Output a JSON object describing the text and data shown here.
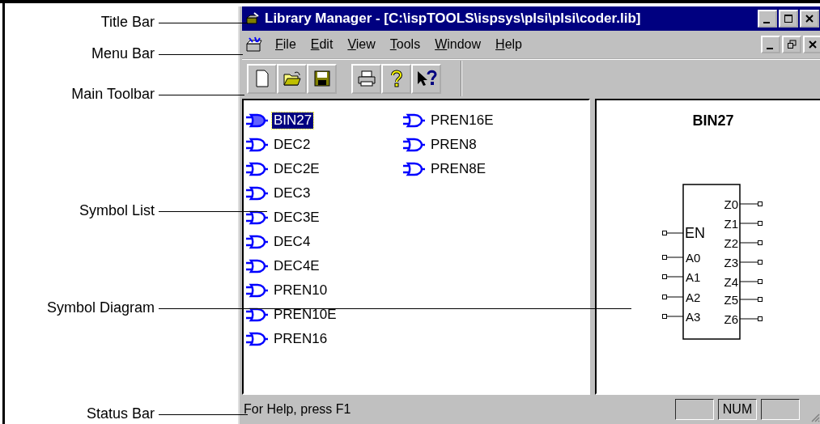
{
  "callouts": [
    "Title Bar",
    "Menu Bar",
    "Main Toolbar",
    "Symbol List",
    "Symbol Diagram",
    "Status Bar"
  ],
  "window": {
    "title": "Library Manager - [C:\\ispTOOLS\\ispsys\\plsi\\plsi\\coder.lib]"
  },
  "menu": [
    "File",
    "Edit",
    "View",
    "Tools",
    "Window",
    "Help"
  ],
  "symbols": [
    {
      "name": "BIN27",
      "selected": true
    },
    {
      "name": "DEC2",
      "selected": false
    },
    {
      "name": "DEC2E",
      "selected": false
    },
    {
      "name": "DEC3",
      "selected": false
    },
    {
      "name": "DEC3E",
      "selected": false
    },
    {
      "name": "DEC4",
      "selected": false
    },
    {
      "name": "DEC4E",
      "selected": false
    },
    {
      "name": "PREN10",
      "selected": false
    },
    {
      "name": "PREN10E",
      "selected": false
    },
    {
      "name": "PREN16",
      "selected": false
    },
    {
      "name": "PREN16E",
      "selected": false
    },
    {
      "name": "PREN8",
      "selected": false
    },
    {
      "name": "PREN8E",
      "selected": false
    }
  ],
  "diagram": {
    "title": "BIN27",
    "inputs": [
      "EN",
      "A0",
      "A1",
      "A2",
      "A3"
    ],
    "outputs": [
      "Z0",
      "Z1",
      "Z2",
      "Z3",
      "Z4",
      "Z5",
      "Z6"
    ]
  },
  "status_bar": {
    "text": "For Help, press F1",
    "indicators": [
      "NUM"
    ]
  }
}
